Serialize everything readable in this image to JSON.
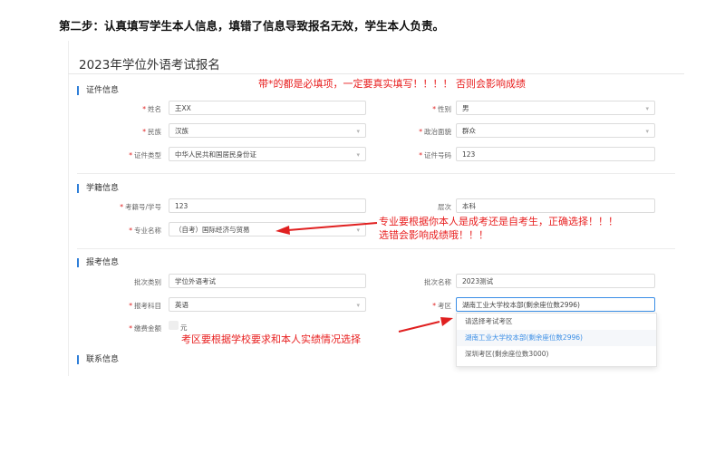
{
  "instruction": "第二步：认真填写学生本人信息，填错了信息导致报名无效，学生本人负责。",
  "form_title": "2023年学位外语考试报名",
  "annotations": {
    "required_note": "带*的都是必填项，一定要真实填写！！！！ 否则会影响成绩",
    "major_note_line1": "专业要根据你本人是成考还是自考生，正确选择！！！",
    "major_note_line2": "选错会影响成绩哦！！！",
    "area_note": "考区要根据学校要求和本人实绩情况选择"
  },
  "sections": {
    "id": "证件信息",
    "student": "学籍信息",
    "exam": "报考信息",
    "contact": "联系信息"
  },
  "fields": {
    "name": {
      "label": "姓名",
      "value": "王XX"
    },
    "gender": {
      "label": "性别",
      "value": "男"
    },
    "ethnicity": {
      "label": "民族",
      "value": "汉族"
    },
    "political": {
      "label": "政治面貌",
      "value": "群众"
    },
    "id_type": {
      "label": "证件类型",
      "value": "中华人民共和国居民身份证"
    },
    "id_number": {
      "label": "证件号码",
      "value": "123"
    },
    "student_no": {
      "label": "考籍号/学号",
      "value": "123"
    },
    "level": {
      "label": "层次",
      "value": "本科"
    },
    "major": {
      "label": "专业名称",
      "value": "（自考）国际经济与贸易"
    },
    "batch_type": {
      "label": "批次类别",
      "value": "学位外语考试"
    },
    "batch_name": {
      "label": "批次名称",
      "value": "2023测试"
    },
    "subject": {
      "label": "报考科目",
      "value": "英语"
    },
    "area": {
      "label": "考区",
      "value": "湖南工业大学校本部(剩余座位数2996)"
    },
    "fee": {
      "label": "缴费金额",
      "unit": "元"
    }
  },
  "area_dropdown": {
    "options": [
      "请选择考试考区",
      "湖南工业大学校本部(剩余座位数2996)",
      "深圳考区(剩余座位数3000)"
    ],
    "selected_index": 1
  },
  "colors": {
    "accent": "#2f7fd8",
    "required": "#e02020",
    "annotation": "#e82020"
  }
}
